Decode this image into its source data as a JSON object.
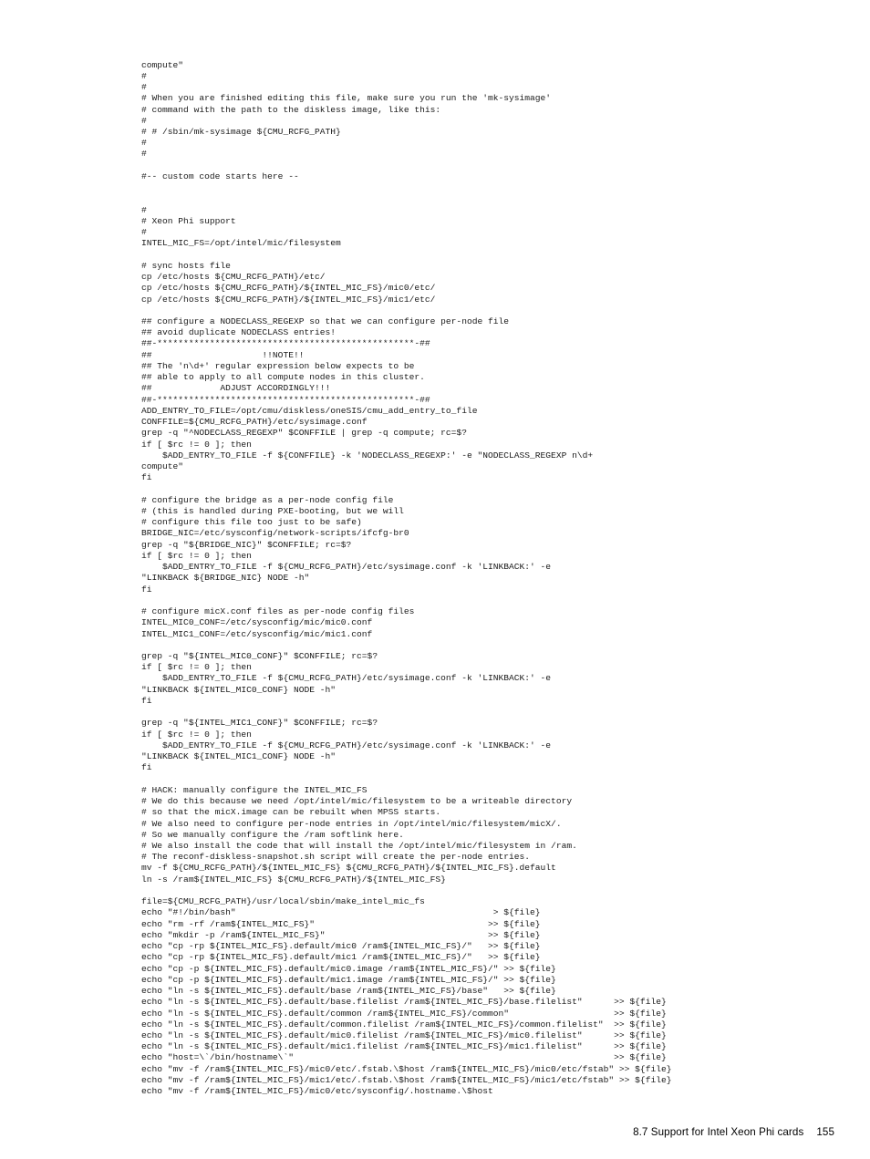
{
  "document": {
    "footer": {
      "section_label": "8.7 Support for Intel Xeon Phi cards",
      "page_number": "155"
    },
    "code_listing": {
      "language": "shell",
      "lines": [
        "compute\"",
        "#",
        "#",
        "# When you are finished editing this file, make sure you run the 'mk-sysimage'",
        "# command with the path to the diskless image, like this:",
        "#",
        "# # /sbin/mk-sysimage ${CMU_RCFG_PATH}",
        "#",
        "#",
        "",
        "#-- custom code starts here --",
        "",
        "",
        "#",
        "# Xeon Phi support",
        "#",
        "INTEL_MIC_FS=/opt/intel/mic/filesystem",
        "",
        "# sync hosts file",
        "cp /etc/hosts ${CMU_RCFG_PATH}/etc/",
        "cp /etc/hosts ${CMU_RCFG_PATH}/${INTEL_MIC_FS}/mic0/etc/",
        "cp /etc/hosts ${CMU_RCFG_PATH}/${INTEL_MIC_FS}/mic1/etc/",
        "",
        "## configure a NODECLASS_REGEXP so that we can configure per-node file",
        "## avoid duplicate NODECLASS entries!",
        "##-*************************************************-##",
        "##                     !!NOTE!!",
        "## The 'n\\d+' regular expression below expects to be",
        "## able to apply to all compute nodes in this cluster.",
        "##             ADJUST ACCORDINGLY!!!",
        "##-*************************************************-##",
        "ADD_ENTRY_TO_FILE=/opt/cmu/diskless/oneSIS/cmu_add_entry_to_file",
        "CONFFILE=${CMU_RCFG_PATH}/etc/sysimage.conf",
        "grep -q \"^NODECLASS_REGEXP\" $CONFFILE | grep -q compute; rc=$?",
        "if [ $rc != 0 ]; then",
        "    $ADD_ENTRY_TO_FILE -f ${CONFFILE} -k 'NODECLASS_REGEXP:' -e \"NODECLASS_REGEXP n\\d+",
        "compute\"",
        "fi",
        "",
        "# configure the bridge as a per-node config file",
        "# (this is handled during PXE-booting, but we will",
        "# configure this file too just to be safe)",
        "BRIDGE_NIC=/etc/sysconfig/network-scripts/ifcfg-br0",
        "grep -q \"${BRIDGE_NIC}\" $CONFFILE; rc=$?",
        "if [ $rc != 0 ]; then",
        "    $ADD_ENTRY_TO_FILE -f ${CMU_RCFG_PATH}/etc/sysimage.conf -k 'LINKBACK:' -e",
        "\"LINKBACK ${BRIDGE_NIC} NODE -h\"",
        "fi",
        "",
        "# configure micX.conf files as per-node config files",
        "INTEL_MIC0_CONF=/etc/sysconfig/mic/mic0.conf",
        "INTEL_MIC1_CONF=/etc/sysconfig/mic/mic1.conf",
        "",
        "grep -q \"${INTEL_MIC0_CONF}\" $CONFFILE; rc=$?",
        "if [ $rc != 0 ]; then",
        "    $ADD_ENTRY_TO_FILE -f ${CMU_RCFG_PATH}/etc/sysimage.conf -k 'LINKBACK:' -e",
        "\"LINKBACK ${INTEL_MIC0_CONF} NODE -h\"",
        "fi",
        "",
        "grep -q \"${INTEL_MIC1_CONF}\" $CONFFILE; rc=$?",
        "if [ $rc != 0 ]; then",
        "    $ADD_ENTRY_TO_FILE -f ${CMU_RCFG_PATH}/etc/sysimage.conf -k 'LINKBACK:' -e",
        "\"LINKBACK ${INTEL_MIC1_CONF} NODE -h\"",
        "fi",
        "",
        "# HACK: manually configure the INTEL_MIC_FS",
        "# We do this because we need /opt/intel/mic/filesystem to be a writeable directory",
        "# so that the micX.image can be rebuilt when MPSS starts.",
        "# We also need to configure per-node entries in /opt/intel/mic/filesystem/micX/.",
        "# So we manually configure the /ram softlink here.",
        "# We also install the code that will install the /opt/intel/mic/filesystem in /ram.",
        "# The reconf-diskless-snapshot.sh script will create the per-node entries.",
        "mv -f ${CMU_RCFG_PATH}/${INTEL_MIC_FS} ${CMU_RCFG_PATH}/${INTEL_MIC_FS}.default",
        "ln -s /ram${INTEL_MIC_FS} ${CMU_RCFG_PATH}/${INTEL_MIC_FS}",
        "",
        "file=${CMU_RCFG_PATH}/usr/local/sbin/make_intel_mic_fs",
        "echo \"#!/bin/bash\"                                                 > ${file}",
        "echo \"rm -rf /ram${INTEL_MIC_FS}\"                                 >> ${file}",
        "echo \"mkdir -p /ram${INTEL_MIC_FS}\"                               >> ${file}",
        "echo \"cp -rp ${INTEL_MIC_FS}.default/mic0 /ram${INTEL_MIC_FS}/\"   >> ${file}",
        "echo \"cp -rp ${INTEL_MIC_FS}.default/mic1 /ram${INTEL_MIC_FS}/\"   >> ${file}",
        "echo \"cp -p ${INTEL_MIC_FS}.default/mic0.image /ram${INTEL_MIC_FS}/\" >> ${file}",
        "echo \"cp -p ${INTEL_MIC_FS}.default/mic1.image /ram${INTEL_MIC_FS}/\" >> ${file}",
        "echo \"ln -s ${INTEL_MIC_FS}.default/base /ram${INTEL_MIC_FS}/base\"   >> ${file}",
        "echo \"ln -s ${INTEL_MIC_FS}.default/base.filelist /ram${INTEL_MIC_FS}/base.filelist\"      >> ${file}",
        "echo \"ln -s ${INTEL_MIC_FS}.default/common /ram${INTEL_MIC_FS}/common\"                    >> ${file}",
        "echo \"ln -s ${INTEL_MIC_FS}.default/common.filelist /ram${INTEL_MIC_FS}/common.filelist\"  >> ${file}",
        "echo \"ln -s ${INTEL_MIC_FS}.default/mic0.filelist /ram${INTEL_MIC_FS}/mic0.filelist\"      >> ${file}",
        "echo \"ln -s ${INTEL_MIC_FS}.default/mic1.filelist /ram${INTEL_MIC_FS}/mic1.filelist\"      >> ${file}",
        "echo \"host=\\`/bin/hostname\\`\"                                                             >> ${file}",
        "echo \"mv -f /ram${INTEL_MIC_FS}/mic0/etc/.fstab.\\$host /ram${INTEL_MIC_FS}/mic0/etc/fstab\" >> ${file}",
        "echo \"mv -f /ram${INTEL_MIC_FS}/mic1/etc/.fstab.\\$host /ram${INTEL_MIC_FS}/mic1/etc/fstab\" >> ${file}",
        "echo \"mv -f /ram${INTEL_MIC_FS}/mic0/etc/sysconfig/.hostname.\\$host"
      ]
    }
  }
}
